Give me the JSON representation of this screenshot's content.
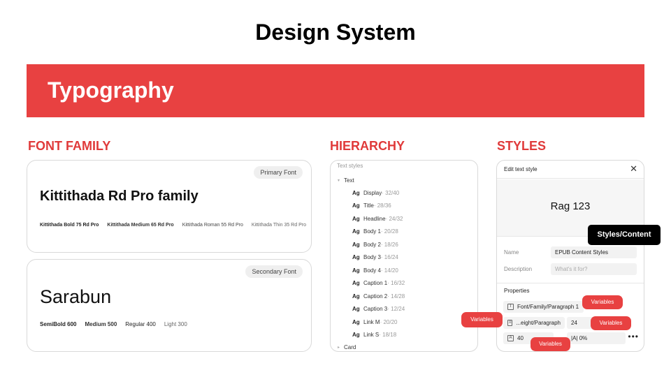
{
  "page": {
    "title": "Design System"
  },
  "banner": {
    "title": "Typography",
    "color": "#e84141"
  },
  "sections": {
    "font_family": "FONT FAMILY",
    "hierarchy": "HIERARCHY",
    "styles": "STYLES"
  },
  "primary_font": {
    "tag": "Primary Font",
    "name": "Kittithada Rd Pro family",
    "weights": [
      "Kittithada Bold 75 Rd Pro",
      "Kittithada Medium 65 Rd Pro",
      "Kittithada Roman 55 Rd Pro",
      "Kittithada Thin 35 Rd Pro"
    ]
  },
  "secondary_font": {
    "tag": "Secondary Font",
    "name": "Sarabun",
    "weights": [
      "SemiBold 600",
      "Medium 500",
      "Regular 400",
      "Light 300"
    ]
  },
  "hierarchy": {
    "title": "Text styles",
    "group": "Text",
    "footer_group": "Card",
    "icon_label": "Ag",
    "items": [
      {
        "name": "Display",
        "size": " · 32/40"
      },
      {
        "name": "Title",
        "size": " · 28/36"
      },
      {
        "name": "Headline",
        "size": " · 24/32"
      },
      {
        "name": "Body 1",
        "size": " · 20/28"
      },
      {
        "name": "Body 2",
        "size": " · 18/26"
      },
      {
        "name": "Body 3",
        "size": " · 16/24"
      },
      {
        "name": "Body 4",
        "size": " · 14/20"
      },
      {
        "name": "Caption 1",
        "size": " · 16/32"
      },
      {
        "name": "Caption 2",
        "size": " · 14/28"
      },
      {
        "name": "Caption 3",
        "size": " · 12/24"
      },
      {
        "name": "Link M",
        "size": " · 20/20"
      },
      {
        "name": "Link S",
        "size": " · 18/18"
      }
    ]
  },
  "styles_panel": {
    "header": "Edit text style",
    "close": "✕",
    "preview": "Rag 123",
    "name_label": "Name",
    "name_value": "EPUB Content Styles",
    "description_label": "Description",
    "description_placeholder": "What's it for?",
    "properties_label": "Properties",
    "font_family_value": "Font/Family/Paragraph 1",
    "font_weight_value": "...eight/Paragraph",
    "font_size_value": "24",
    "line_height_value": "40",
    "letter_spacing_value": "|A| 0%",
    "more": "•••"
  },
  "badges": {
    "variables": "Variables",
    "callout": "Styles/Content"
  },
  "colors": {
    "accent": "#e84141",
    "heading": "#e03a3a"
  }
}
